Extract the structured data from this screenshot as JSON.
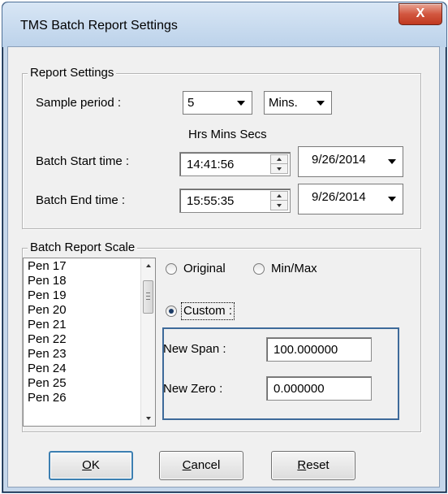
{
  "window": {
    "title": "TMS Batch Report Settings",
    "close_glyph": "X"
  },
  "report_settings": {
    "group_title": "Report Settings",
    "sample_period_label": "Sample  period :",
    "sample_period_value": "5",
    "sample_unit_value": "Mins.",
    "time_header": "Hrs Mins Secs",
    "start_label": "Batch Start  time :",
    "start_time": "14:41:56",
    "start_date": "9/26/2014",
    "end_label": "Batch End time :",
    "end_time": "15:55:35",
    "end_date": "9/26/2014"
  },
  "batch_scale": {
    "group_title": "Batch Report Scale",
    "pens": [
      "Pen 17",
      "Pen 18",
      "Pen 19",
      "Pen 20",
      "Pen 21",
      "Pen 22",
      "Pen 23",
      "Pen 24",
      "Pen 25",
      "Pen 26"
    ],
    "option_original": "Original",
    "option_minmax": "Min/Max",
    "option_custom": "Custom :",
    "selected_option": "Custom :",
    "new_span_label": "New Span :",
    "new_span_value": "100.000000",
    "new_zero_label": "New Zero :",
    "new_zero_value": "0.000000"
  },
  "buttons": {
    "ok_mnemonic": "O",
    "ok_rest": "K",
    "cancel_mnemonic": "C",
    "cancel_rest": "ancel",
    "reset_mnemonic": "R",
    "reset_rest": "eset"
  },
  "colors": {
    "accent": "#3e6a9a",
    "close_button": "#c0391f",
    "dialog_bg": "#f0f0f0"
  }
}
